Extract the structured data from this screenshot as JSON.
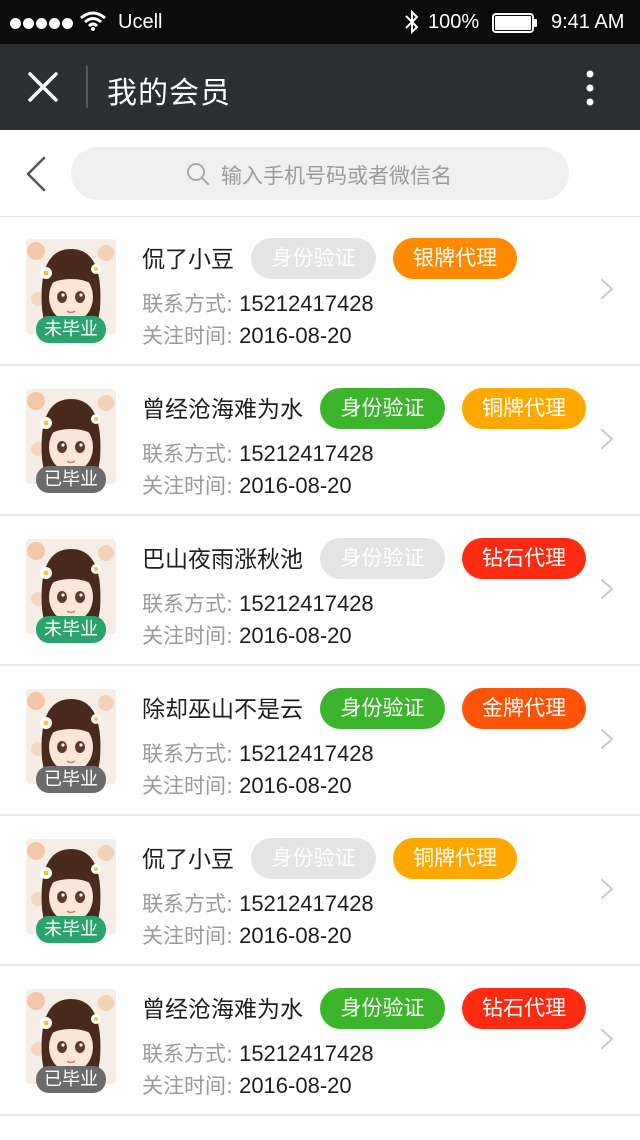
{
  "status_bar": {
    "carrier": "Ucell",
    "battery": "100%",
    "time": "9:41 AM"
  },
  "header": {
    "title": "我的会员",
    "close_icon": "close-icon",
    "more_icon": "more-vertical-icon"
  },
  "search": {
    "placeholder": "输入手机号码或者微信名",
    "back_icon": "back-chevron-icon",
    "search_icon": "search-icon"
  },
  "labels": {
    "contact": "联系方式:",
    "follow_time": "关注时间:"
  },
  "colors": {
    "verify_active": "#3cb52c",
    "verify_inactive": "#e4e4e4",
    "silver_agent": "#ff8a00",
    "bronze_agent": "#ffa800",
    "diamond_agent": "#ff2a12",
    "gold_agent": "#ff5308",
    "badge_not_graduated": "#2aa36e",
    "badge_graduated": "#6b6b6b"
  },
  "members": [
    {
      "name": "侃了小豆",
      "verify": "身份验证",
      "verified": false,
      "agent": "银牌代理",
      "agent_color": "#ff8a00",
      "badge": "未毕业",
      "badge_type": "green",
      "phone": "15212417428",
      "follow_date": "2016-08-20"
    },
    {
      "name": "曾经沧海难为水",
      "verify": "身份验证",
      "verified": true,
      "agent": "铜牌代理",
      "agent_color": "#ffa800",
      "badge": "已毕业",
      "badge_type": "grey",
      "phone": "15212417428",
      "follow_date": "2016-08-20"
    },
    {
      "name": "巴山夜雨涨秋池",
      "verify": "身份验证",
      "verified": false,
      "agent": "钻石代理",
      "agent_color": "#ff2a12",
      "badge": "未毕业",
      "badge_type": "green",
      "phone": "15212417428",
      "follow_date": "2016-08-20"
    },
    {
      "name": "除却巫山不是云",
      "verify": "身份验证",
      "verified": true,
      "agent": "金牌代理",
      "agent_color": "#ff5308",
      "badge": "已毕业",
      "badge_type": "grey",
      "phone": "15212417428",
      "follow_date": "2016-08-20"
    },
    {
      "name": "侃了小豆",
      "verify": "身份验证",
      "verified": false,
      "agent": "铜牌代理",
      "agent_color": "#ffa800",
      "badge": "未毕业",
      "badge_type": "green",
      "phone": "15212417428",
      "follow_date": "2016-08-20"
    },
    {
      "name": "曾经沧海难为水",
      "verify": "身份验证",
      "verified": true,
      "agent": "钻石代理",
      "agent_color": "#ff2a12",
      "badge": "已毕业",
      "badge_type": "grey",
      "phone": "15212417428",
      "follow_date": "2016-08-20"
    }
  ]
}
